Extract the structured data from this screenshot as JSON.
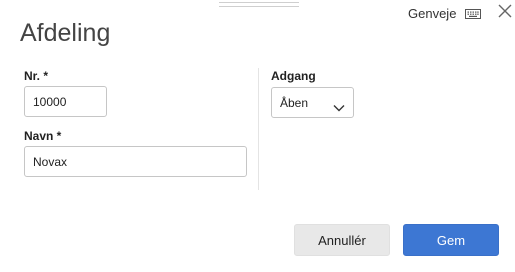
{
  "header": {
    "title": "Afdeling",
    "shortcuts_label": "Genveje"
  },
  "form": {
    "number": {
      "label": "Nr. *",
      "value": "10000"
    },
    "name": {
      "label": "Navn *",
      "value": "Novax"
    },
    "access": {
      "label": "Adgang",
      "selected": "Åben"
    }
  },
  "actions": {
    "cancel_label": "Annullér",
    "save_label": "Gem"
  },
  "colors": {
    "primary": "#3d77d3",
    "secondary_button": "#e8e8e8"
  }
}
